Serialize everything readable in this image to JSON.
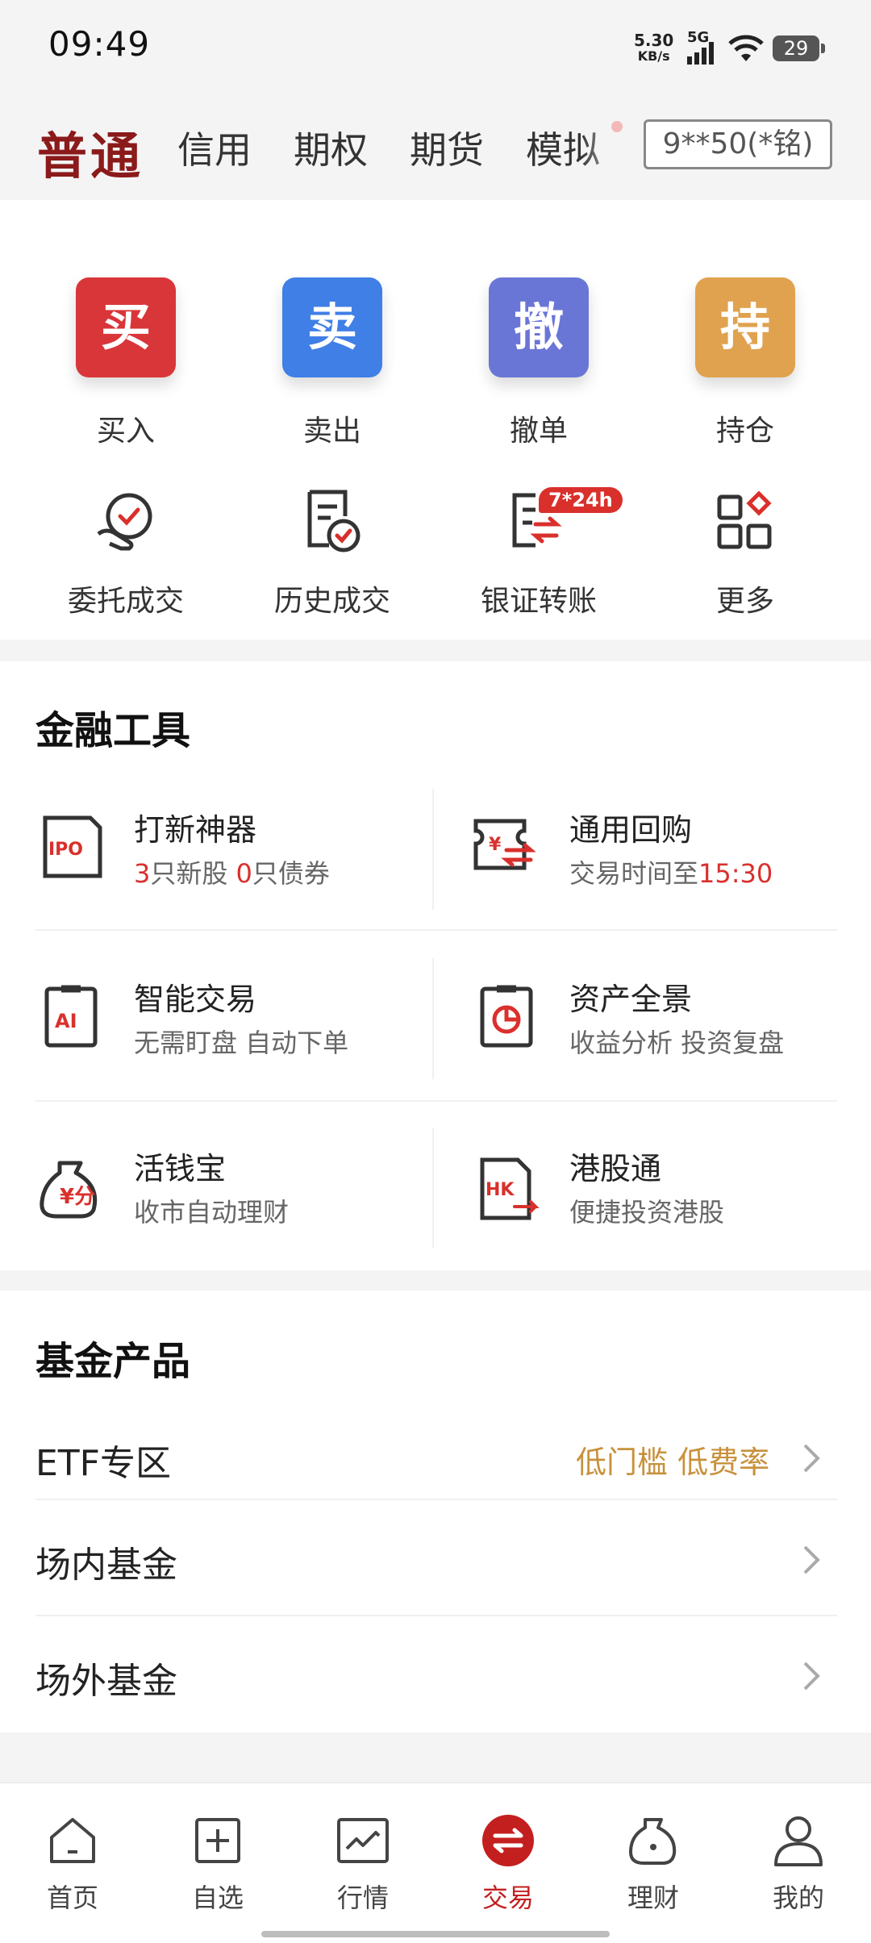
{
  "status": {
    "time": "09:49",
    "net_speed": "5.30",
    "net_unit": "KB/s",
    "network": "5G",
    "battery": "29"
  },
  "tabs": [
    "普通",
    "信用",
    "期权",
    "期货",
    "模拟"
  ],
  "account": "9**50(*铭)",
  "quick_actions": [
    {
      "glyph": "买",
      "label": "买入",
      "color": "#d9363a"
    },
    {
      "glyph": "卖",
      "label": "卖出",
      "color": "#3f7fe6"
    },
    {
      "glyph": "撤",
      "label": "撤单",
      "color": "#6a76d6"
    },
    {
      "glyph": "持",
      "label": "持仓",
      "color": "#e0a24f"
    }
  ],
  "secondary_actions": [
    {
      "label": "委托成交",
      "icon": "entrust-icon"
    },
    {
      "label": "历史成交",
      "icon": "history-icon"
    },
    {
      "label": "银证转账",
      "icon": "transfer-icon",
      "badge": "7*24h"
    },
    {
      "label": "更多",
      "icon": "more-grid-icon"
    }
  ],
  "finance_tools": {
    "title": "金融工具",
    "items": [
      {
        "title": "打新神器",
        "sub_a_num": "3",
        "sub_a": "只新股 ",
        "sub_b_num": "0",
        "sub_b": "只债券",
        "icon": "ipo-icon",
        "icon_text": "IPO"
      },
      {
        "title": "通用回购",
        "sub": "交易时间至",
        "sub_red": "15:30",
        "icon": "repo-icon"
      },
      {
        "title": "智能交易",
        "sub": "无需盯盘 自动下单",
        "icon": "ai-trade-icon",
        "icon_text": "AI"
      },
      {
        "title": "资产全景",
        "sub": "收益分析 投资复盘",
        "icon": "asset-pie-icon"
      },
      {
        "title": "活钱宝",
        "sub": "收市自动理财",
        "icon": "money-bag-icon"
      },
      {
        "title": "港股通",
        "sub": "便捷投资港股",
        "icon": "hk-stock-icon",
        "icon_text": "HK"
      }
    ]
  },
  "fund_products": {
    "title": "基金产品",
    "rows": [
      {
        "label": "ETF专区",
        "extra": "低门槛 低费率"
      },
      {
        "label": "场内基金",
        "extra": ""
      },
      {
        "label": "场外基金",
        "extra": ""
      }
    ]
  },
  "nav": [
    {
      "label": "首页",
      "icon": "home-icon"
    },
    {
      "label": "自选",
      "icon": "watchlist-add-icon"
    },
    {
      "label": "行情",
      "icon": "market-chart-icon"
    },
    {
      "label": "交易",
      "icon": "trade-exchange-icon",
      "active": true
    },
    {
      "label": "理财",
      "icon": "wealth-bag-icon"
    },
    {
      "label": "我的",
      "icon": "profile-icon"
    }
  ],
  "colors": {
    "brand": "#8b1a1a",
    "accent_red": "#d9302c",
    "gold": "#c8913c"
  }
}
